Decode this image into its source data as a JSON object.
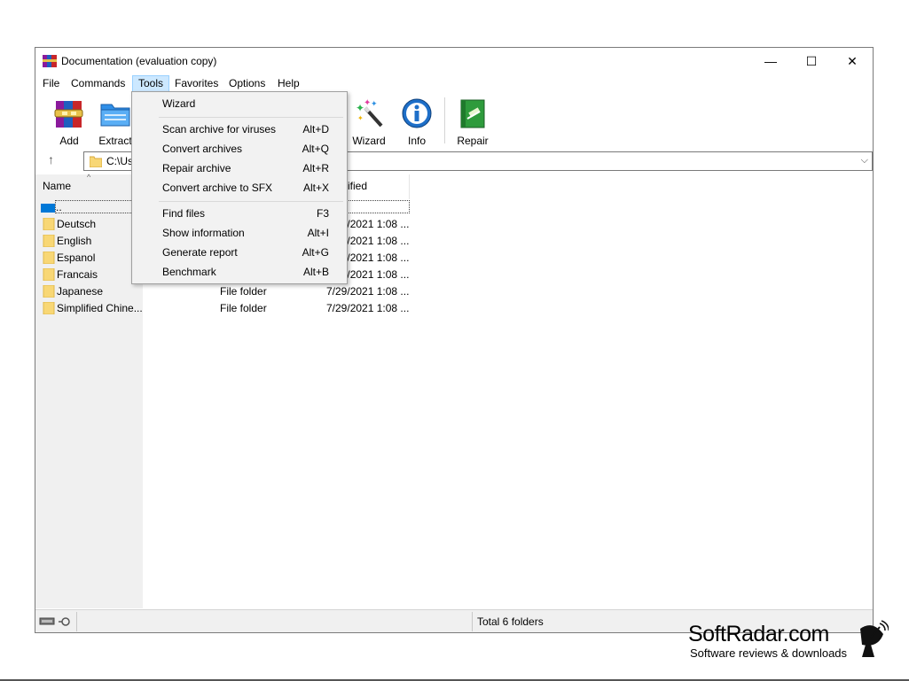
{
  "window": {
    "title": "Documentation (evaluation copy)",
    "controls": {
      "minimize": "—",
      "maximize": "☐",
      "close": "✕"
    }
  },
  "menubar": {
    "items": [
      "File",
      "Commands",
      "Tools",
      "Favorites",
      "Options",
      "Help"
    ],
    "active": "Tools"
  },
  "toolbar": {
    "buttons": [
      "Add",
      "Extract",
      "Wizard",
      "Info",
      "Repair"
    ]
  },
  "address": {
    "up_glyph": "↑",
    "path": "C:\\Us",
    "chevron": "⌵"
  },
  "filelist": {
    "columns": {
      "name": "Name",
      "modified": "ified",
      "sort_glyph": "^"
    },
    "parent_label": "..",
    "rows": [
      {
        "name": "Deutsch",
        "type": "",
        "date": "7/29/2021 1:08 ..."
      },
      {
        "name": "English",
        "type": "",
        "date": "7/29/2021 1:08 ..."
      },
      {
        "name": "Espanol",
        "type": "",
        "date": "7/29/2021 1:08 ..."
      },
      {
        "name": "Francais",
        "type": "",
        "date": "7/29/2021 1:08 ..."
      },
      {
        "name": "Japanese",
        "type": "File folder",
        "date": "7/29/2021 1:08 ..."
      },
      {
        "name": "Simplified Chine...",
        "type": "File folder",
        "date": "7/29/2021 1:08 ..."
      }
    ],
    "hidden_dates": [
      "/2021 1:08 ...",
      "/2021 1:08 ...",
      "/2021 1:08 ...",
      "/2021 1:08 ..."
    ]
  },
  "tools_menu": {
    "items": [
      {
        "label": "Wizard",
        "key": ""
      },
      {
        "label": "Scan archive for viruses",
        "key": "Alt+D"
      },
      {
        "label": "Convert archives",
        "key": "Alt+Q"
      },
      {
        "label": "Repair archive",
        "key": "Alt+R"
      },
      {
        "label": "Convert archive to SFX",
        "key": "Alt+X"
      },
      {
        "label": "Find files",
        "key": "F3"
      },
      {
        "label": "Show information",
        "key": "Alt+I"
      },
      {
        "label": "Generate report",
        "key": "Alt+G"
      },
      {
        "label": "Benchmark",
        "key": "Alt+B"
      }
    ]
  },
  "status": {
    "text": "Total 6 folders"
  },
  "watermark": {
    "title": "SoftRadar.com",
    "subtitle": "Software reviews & downloads"
  },
  "colors": {
    "menu_active_bg": "#cce8ff",
    "selection": "#0078d7",
    "folder": "#f8d775",
    "info_blue": "#1e6fc8",
    "repair_green": "#2e9b3c"
  }
}
